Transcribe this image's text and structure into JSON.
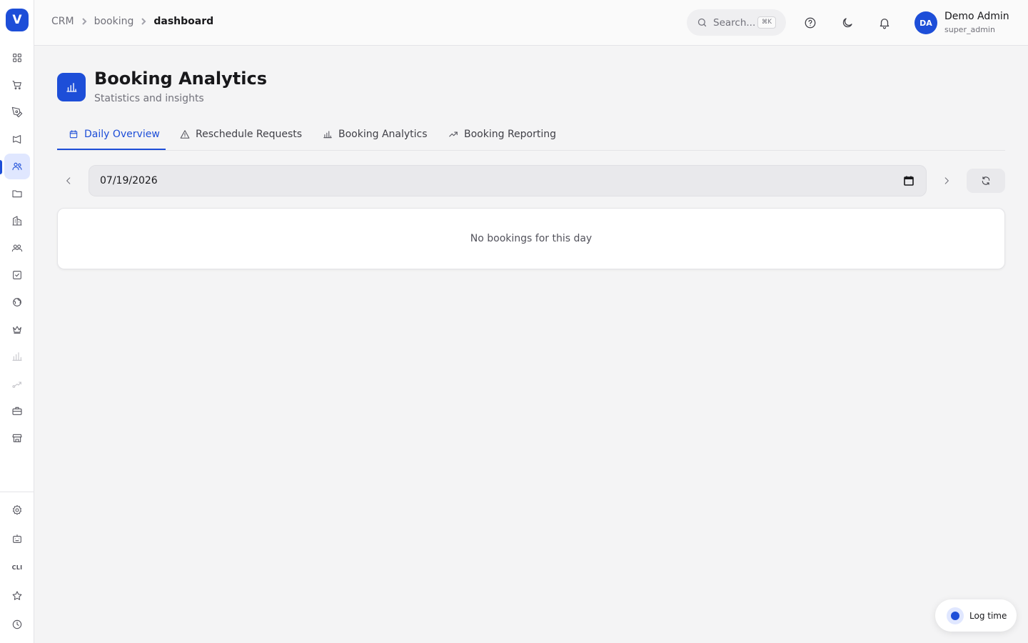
{
  "app": {
    "logo_letter": "V"
  },
  "sidebar": {
    "items": [
      {
        "icon": "dashboard-grid-icon"
      },
      {
        "icon": "cart-icon"
      },
      {
        "icon": "pen-tool-icon"
      },
      {
        "icon": "megaphone-icon"
      },
      {
        "icon": "users-icon",
        "active": true
      },
      {
        "icon": "folder-icon"
      },
      {
        "icon": "building-icon"
      },
      {
        "icon": "contacts-icon"
      },
      {
        "icon": "checkbox-icon"
      },
      {
        "icon": "globe-icon"
      },
      {
        "icon": "crown-icon"
      },
      {
        "icon": "bar-chart-icon",
        "disabled": true
      },
      {
        "icon": "route-icon",
        "disabled": true
      },
      {
        "icon": "briefcase-icon"
      },
      {
        "icon": "store-icon"
      }
    ],
    "bottom": {
      "cli_label": "CLI"
    }
  },
  "header": {
    "breadcrumb": [
      "CRM",
      "booking",
      "dashboard"
    ],
    "search_placeholder": "Search...",
    "search_shortcut": "⌘K",
    "user": {
      "initials": "DA",
      "name": "Demo Admin",
      "role": "super_admin"
    }
  },
  "page": {
    "title": "Booking Analytics",
    "subtitle": "Statistics and insights"
  },
  "tabs": [
    {
      "label": "Daily Overview",
      "active": true
    },
    {
      "label": "Reschedule Requests"
    },
    {
      "label": "Booking Analytics"
    },
    {
      "label": "Booking Reporting"
    }
  ],
  "date_picker": {
    "value": "07/19/2026"
  },
  "empty_state": {
    "message": "No bookings for this day"
  },
  "log_time": {
    "label": "Log time"
  },
  "colors": {
    "accent": "#1d4ed8",
    "background": "#f4f4f5"
  }
}
